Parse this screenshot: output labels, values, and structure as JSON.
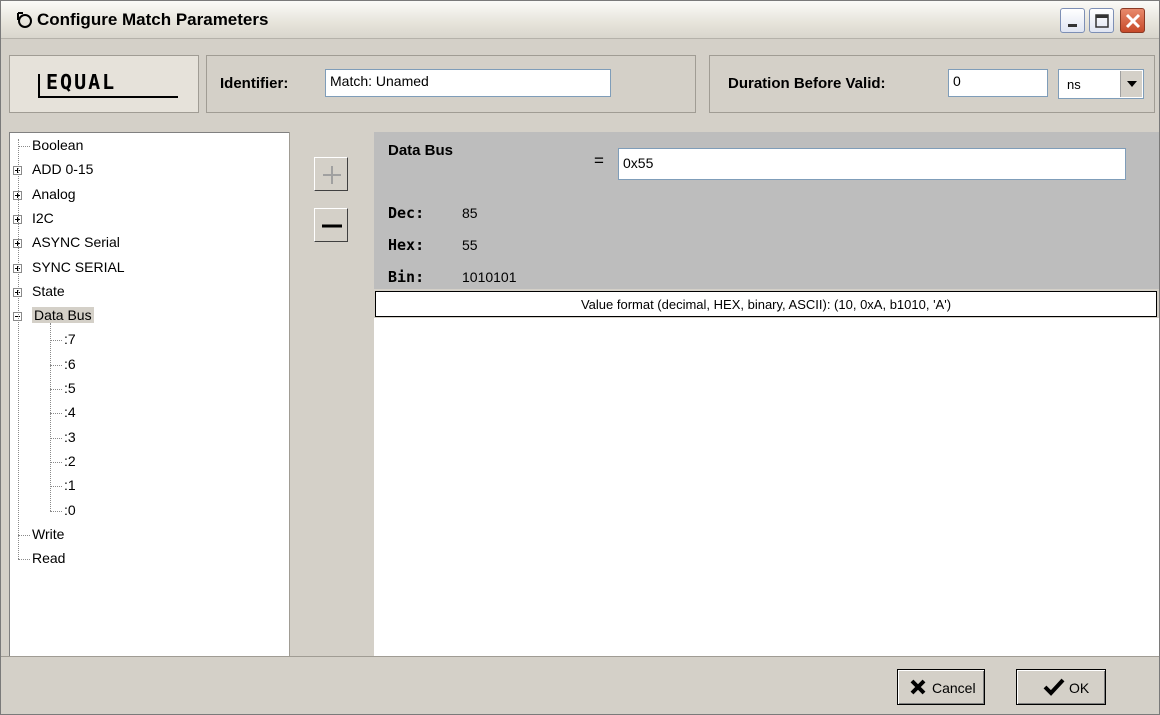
{
  "window": {
    "title": "Configure Match Parameters"
  },
  "header": {
    "logo_text": "EQUAL",
    "identifier_label": "Identifier:",
    "identifier_value": "Match: Unamed",
    "duration_label": "Duration Before Valid:",
    "duration_value": "0",
    "unit_value": "ns"
  },
  "tree": {
    "items": [
      {
        "label": "Boolean",
        "expander": "none"
      },
      {
        "label": "ADD 0-15",
        "expander": "plus"
      },
      {
        "label": "Analog",
        "expander": "plus"
      },
      {
        "label": "I2C",
        "expander": "plus"
      },
      {
        "label": "ASYNC Serial",
        "expander": "plus"
      },
      {
        "label": "SYNC SERIAL",
        "expander": "plus"
      },
      {
        "label": "State",
        "expander": "plus"
      },
      {
        "label": "Data Bus",
        "expander": "minus",
        "selected": true
      },
      {
        "label": ":7",
        "expander": "child"
      },
      {
        "label": ":6",
        "expander": "child"
      },
      {
        "label": ":5",
        "expander": "child"
      },
      {
        "label": ":4",
        "expander": "child"
      },
      {
        "label": ":3",
        "expander": "child"
      },
      {
        "label": ":2",
        "expander": "child"
      },
      {
        "label": ":1",
        "expander": "child"
      },
      {
        "label": ":0",
        "expander": "child"
      },
      {
        "label": "Write",
        "expander": "none"
      },
      {
        "label": "Read",
        "expander": "none"
      }
    ]
  },
  "panel": {
    "bus_title": "Data Bus",
    "equals": "=",
    "value": "0x55",
    "dec_label": "Dec:",
    "dec_value": "85",
    "hex_label": "Hex:",
    "hex_value": "55",
    "bin_label": "Bin:",
    "bin_value": "1010101",
    "hint": "Value format (decimal, HEX, binary, ASCII):  (10, 0xA, b1010, 'A')"
  },
  "footer": {
    "cancel_label": "Cancel",
    "ok_label": "OK"
  }
}
